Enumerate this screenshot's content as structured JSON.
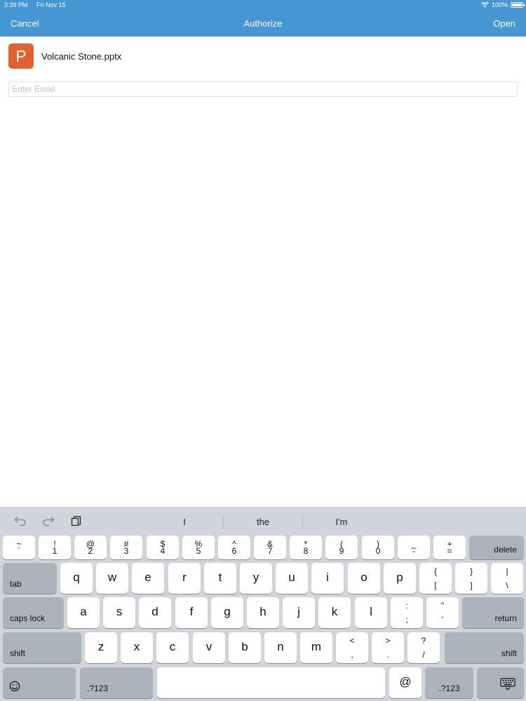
{
  "status": {
    "time": "3:39 PM",
    "date": "Fri Nov 15",
    "battery": "100%",
    "wifi_icon": "wifi-icon",
    "battery_icon": "battery-icon"
  },
  "nav": {
    "cancel": "Cancel",
    "title": "Authorize",
    "open": "Open"
  },
  "file": {
    "icon_letter": "P",
    "name": "Volcanic Stone.pptx"
  },
  "email": {
    "placeholder": "Enter Email",
    "value": ""
  },
  "keyboard": {
    "toolbar": {
      "undo_icon": "undo-icon",
      "redo_icon": "redo-icon",
      "paste_icon": "paste-icon"
    },
    "suggestions": [
      "I",
      "the",
      "I'm"
    ],
    "numbers": [
      {
        "top": "~",
        "bottom": "`"
      },
      {
        "top": "!",
        "bottom": "1"
      },
      {
        "top": "@",
        "bottom": "2"
      },
      {
        "top": "#",
        "bottom": "3"
      },
      {
        "top": "$",
        "bottom": "4"
      },
      {
        "top": "%",
        "bottom": "5"
      },
      {
        "top": "^",
        "bottom": "6"
      },
      {
        "top": "&",
        "bottom": "7"
      },
      {
        "top": "*",
        "bottom": "8"
      },
      {
        "top": "(",
        "bottom": "9"
      },
      {
        "top": ")",
        "bottom": "0"
      },
      {
        "top": "_",
        "bottom": "-"
      },
      {
        "top": "+",
        "bottom": "="
      }
    ],
    "delete": "delete",
    "tab": "tab",
    "row_q": [
      "q",
      "w",
      "e",
      "r",
      "t",
      "y",
      "u",
      "i",
      "o",
      "p"
    ],
    "row_q_symbols": [
      {
        "top": "{",
        "bottom": "["
      },
      {
        "top": "}",
        "bottom": "]"
      },
      {
        "top": "|",
        "bottom": "\\"
      }
    ],
    "caps_lock": "caps lock",
    "row_a": [
      "a",
      "s",
      "d",
      "f",
      "g",
      "h",
      "j",
      "k",
      "l"
    ],
    "row_a_symbols": [
      {
        "top": ":",
        "bottom": ";"
      },
      {
        "top": "\"",
        "bottom": "'"
      }
    ],
    "return": "return",
    "shift": "shift",
    "row_z": [
      "z",
      "x",
      "c",
      "v",
      "b",
      "n",
      "m"
    ],
    "row_z_symbols": [
      {
        "top": "<",
        "bottom": ","
      },
      {
        "top": ">",
        "bottom": "."
      },
      {
        "top": "?",
        "bottom": "/"
      }
    ],
    "emoji_icon": "emoji-icon",
    "numbers_mode": ".?123",
    "at": "@",
    "dismiss_icon": "keyboard-dismiss-icon"
  }
}
